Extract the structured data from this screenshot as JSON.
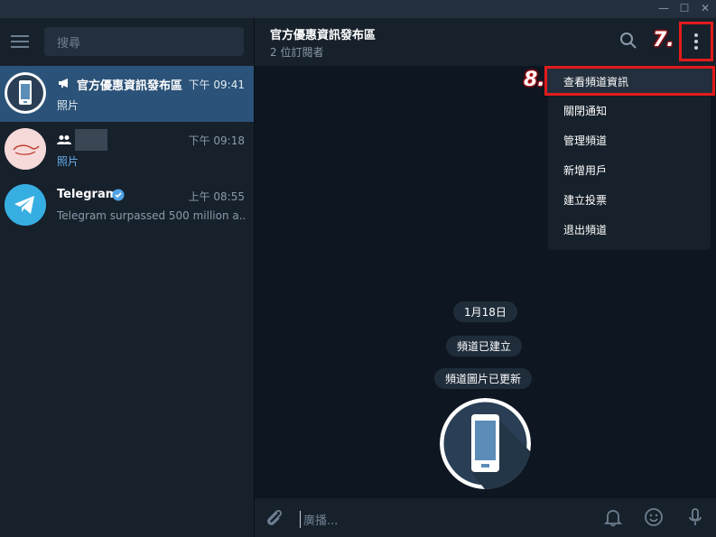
{
  "window": {
    "minimize": "—",
    "maximize": "☐",
    "close": "✕"
  },
  "sidebar": {
    "search_placeholder": "搜尋",
    "chats": [
      {
        "name": "官方優惠資訊發布區",
        "time": "下午 09:41",
        "preview": "照片"
      },
      {
        "name": "",
        "time": "下午 09:18",
        "preview": "照片"
      },
      {
        "name": "Telegram",
        "time": "上午 08:55",
        "preview": "Telegram surpassed 500 million a..."
      }
    ]
  },
  "header": {
    "title": "官方優惠資訊發布區",
    "subtitle": "2 位訂閱者"
  },
  "annotations": {
    "step7": "7.",
    "step8": "8."
  },
  "menu": {
    "items": [
      "查看頻道資訊",
      "關閉通知",
      "管理頻道",
      "新增用戶",
      "建立投票",
      "退出頻道"
    ]
  },
  "messages": {
    "date": "1月18日",
    "created": "頻道已建立",
    "photo_updated": "頻道圖片已更新"
  },
  "compose": {
    "placeholder": "廣播..."
  },
  "colors": {
    "accent": "#2b5278",
    "link": "#6ab3f3",
    "highlight_border": "#e21b1b",
    "telegram_blue": "#37aee2"
  }
}
